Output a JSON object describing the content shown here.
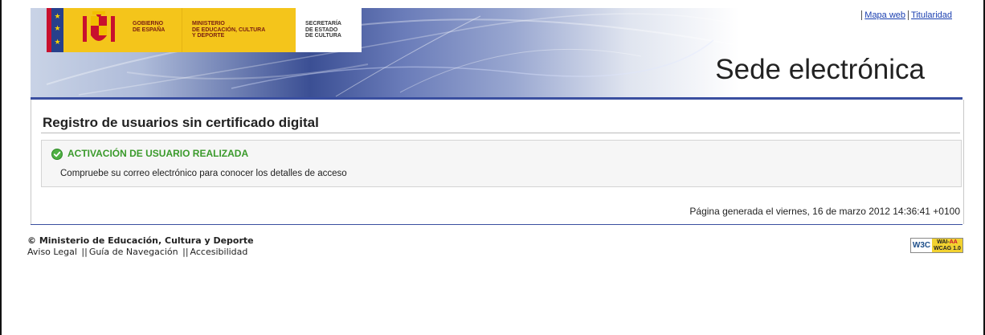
{
  "header": {
    "gov_label_1": "GOBIERNO",
    "gov_label_2": "DE ESPAÑA",
    "ministry_1": "MINISTERIO",
    "ministry_2": "DE EDUCACIÓN, CULTURA",
    "ministry_3": "Y DEPORTE",
    "secretary_1": "SECRETARÍA",
    "secretary_2": "DE ESTADO",
    "secretary_3": "DE CULTURA",
    "site_title": "Sede electrónica",
    "links": [
      "Mapa web",
      "Titularidad"
    ],
    "colors": {
      "flag_red": "#c8102e",
      "flag_yellow": "#f4c51b",
      "accent": "#3a4fa0"
    }
  },
  "main": {
    "heading": "Registro de usuarios sin certificado digital",
    "message": {
      "icon": "check-circle-icon",
      "title": "ACTIVACIÓN DE USUARIO REALIZADA",
      "text": "Compruebe su correo electrónico para conocer los detalles de acceso",
      "color": "#3a9a2b"
    },
    "generated": "Página generada el viernes, 16 de marzo 2012 14:36:41 +0100"
  },
  "footer": {
    "copyright": "© Ministerio de Educación, Cultura y Deporte",
    "links": [
      "Aviso Legal",
      "Guía de Navegación",
      "Accesibilidad"
    ],
    "separator": "||",
    "badge_left": "W3C",
    "badge_top": "WAI-",
    "badge_top_red": "AA",
    "badge_bottom": "WCAG 1.0"
  }
}
